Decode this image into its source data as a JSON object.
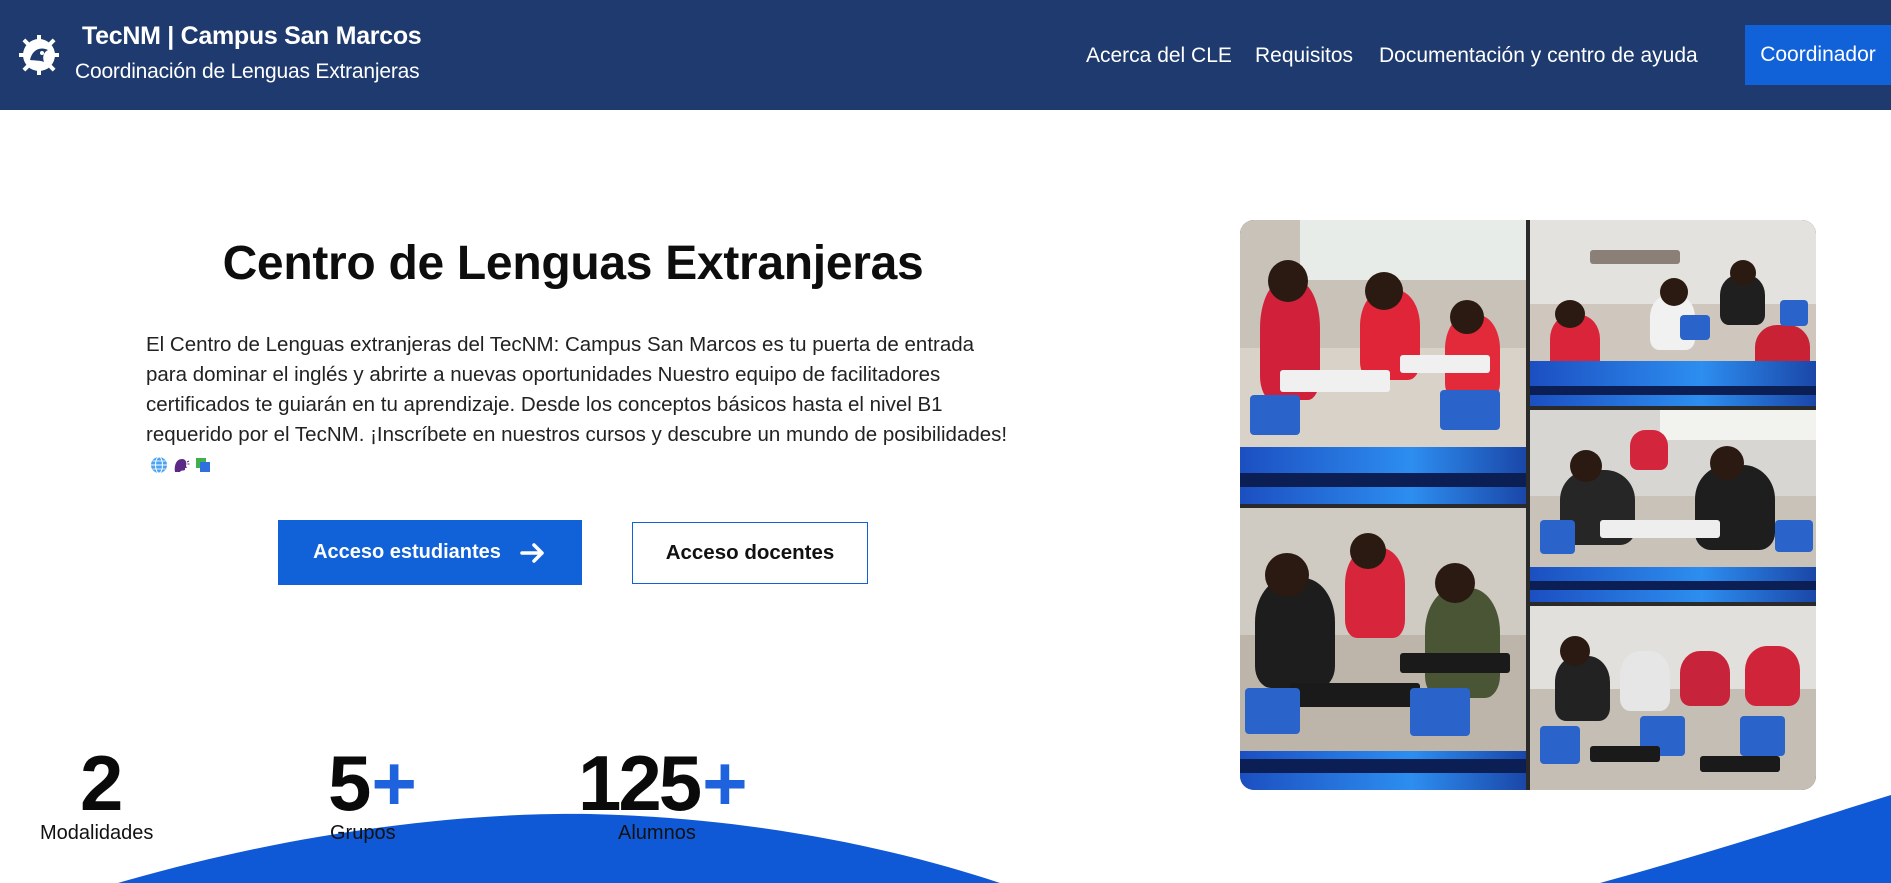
{
  "header": {
    "title": "TecNM | Campus San Marcos",
    "subtitle": "Coordinación de Lenguas Extranjeras",
    "nav": [
      "Acerca del CLE",
      "Requisitos",
      "Documentación y centro de ayuda"
    ],
    "coordinator_label": "Coordinador"
  },
  "hero": {
    "title": "Centro de Lenguas Extranjeras",
    "description": "El Centro de Lenguas extranjeras del TecNM: Campus San Marcos es tu puerta de entrada para dominar el inglés y abrirte a nuevas oportunidades Nuestro equipo de facilitadores certificados te guiarán en tu aprendizaje. Desde los conceptos básicos hasta el nivel B1 requerido por el TecNM. ¡Inscríbete en nuestros cursos y descubre un mundo de posibilidades!",
    "emoji_icons": [
      "globe-icon",
      "speaking-head-icon",
      "flashcards-icon"
    ],
    "student_button": "Acceso estudiantes",
    "teacher_button": "Acceso docentes"
  },
  "stats": [
    {
      "value": "2",
      "suffix": "",
      "label": "Modalidades"
    },
    {
      "value": "5",
      "suffix": "+",
      "label": "Grupos"
    },
    {
      "value": "125",
      "suffix": "+",
      "label": "Alumnos"
    }
  ],
  "colors": {
    "header_bg": "#1e3a6e",
    "accent": "#1161d8",
    "plus": "#1e63dd"
  }
}
